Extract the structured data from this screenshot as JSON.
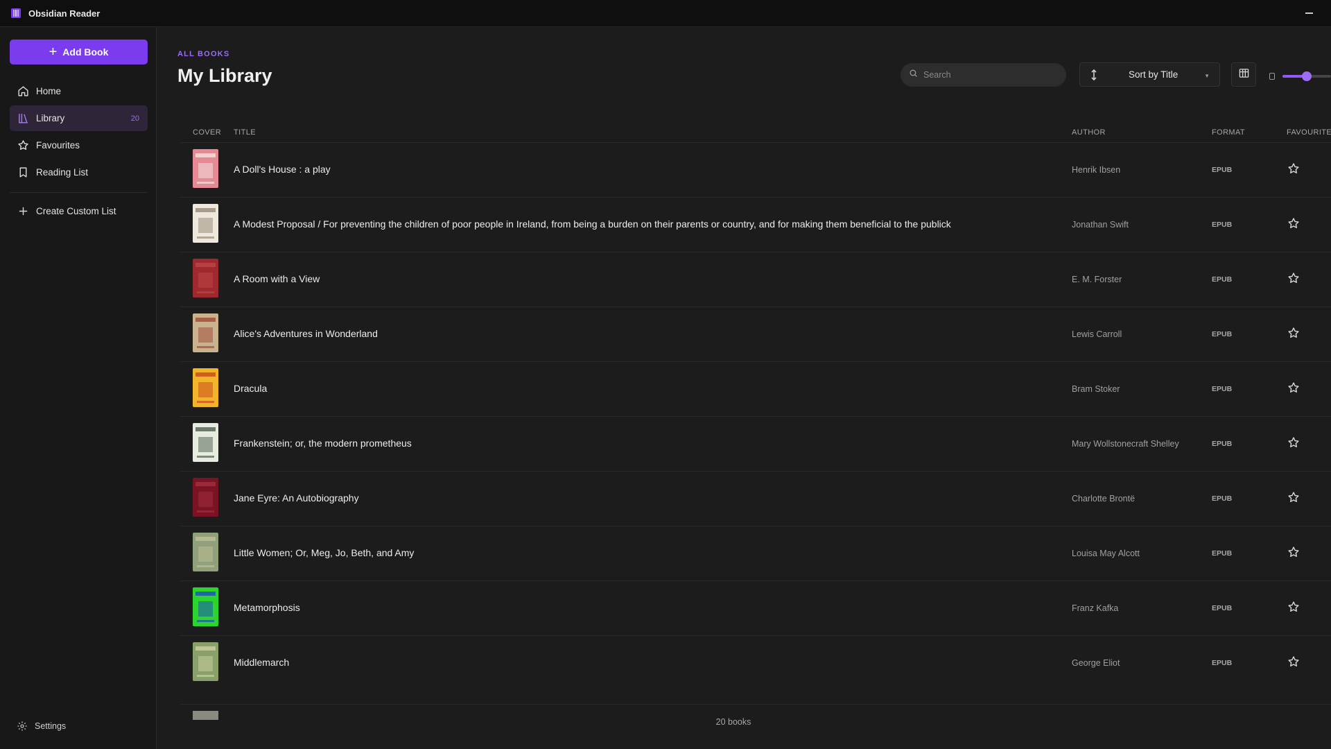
{
  "app": {
    "name": "Obsidian Reader"
  },
  "sidebar": {
    "add_book_label": "Add Book",
    "items": [
      {
        "label": "Home",
        "icon": "home-icon"
      },
      {
        "label": "Library",
        "icon": "library-icon",
        "badge": "20",
        "active": true
      },
      {
        "label": "Favourites",
        "icon": "star-icon"
      },
      {
        "label": "Reading List",
        "icon": "bookmark-icon"
      }
    ],
    "create_list_label": "Create Custom List",
    "settings_label": "Settings"
  },
  "header": {
    "breadcrumb": "ALL BOOKS",
    "title": "My Library",
    "search_placeholder": "Search",
    "sort_label": "Sort by Title",
    "zoom_level": 0.5
  },
  "table": {
    "columns": {
      "cover": "COVER",
      "title": "TITLE",
      "author": "AUTHOR",
      "format": "FORMAT",
      "favourite": "FAVOURITE"
    },
    "rows": [
      {
        "title": "A Doll's House : a play",
        "author": "Henrik Ibsen",
        "format": "EPUB",
        "cover_color": "#e58a94",
        "cover_accent": "#f5f0ea"
      },
      {
        "title": "A Modest Proposal / For preventing the children of poor people in Ireland, from being a burden on their parents or country, and for making them beneficial to the publick",
        "author": "Jonathan Swift",
        "format": "EPUB",
        "cover_color": "#efe8dc",
        "cover_accent": "#8a7c6a"
      },
      {
        "title": "A Room with a View",
        "author": "E. M. Forster",
        "format": "EPUB",
        "cover_color": "#9e2a2f",
        "cover_accent": "#c24a4a"
      },
      {
        "title": "Alice's Adventures in Wonderland",
        "author": "Lewis Carroll",
        "format": "EPUB",
        "cover_color": "#c9b38f",
        "cover_accent": "#9c3a2a"
      },
      {
        "title": "Dracula",
        "author": "Bram Stoker",
        "format": "EPUB",
        "cover_color": "#f2b52a",
        "cover_accent": "#c03a1a"
      },
      {
        "title": "Frankenstein; or, the modern prometheus",
        "author": "Mary Wollstonecraft Shelley",
        "format": "EPUB",
        "cover_color": "#e6ece0",
        "cover_accent": "#3a4a3a"
      },
      {
        "title": "Jane Eyre: An Autobiography",
        "author": "Charlotte Brontë",
        "format": "EPUB",
        "cover_color": "#7a1424",
        "cover_accent": "#a83245"
      },
      {
        "title": "Little Women; Or, Meg, Jo, Beth, and Amy",
        "author": "Louisa May Alcott",
        "format": "EPUB",
        "cover_color": "#8fa07a",
        "cover_accent": "#c8c49a"
      },
      {
        "title": "Metamorphosis",
        "author": "Franz Kafka",
        "format": "EPUB",
        "cover_color": "#2ed42e",
        "cover_accent": "#1a3ad4"
      },
      {
        "title": "Middlemarch",
        "author": "George Eliot",
        "format": "EPUB",
        "cover_color": "#8aa06a",
        "cover_accent": "#d4d8a8"
      }
    ]
  },
  "footer": {
    "count_label": "20 books"
  },
  "colors": {
    "accent": "#7b3cf0",
    "background": "#1c1c1c",
    "sidebar": "#181818"
  }
}
